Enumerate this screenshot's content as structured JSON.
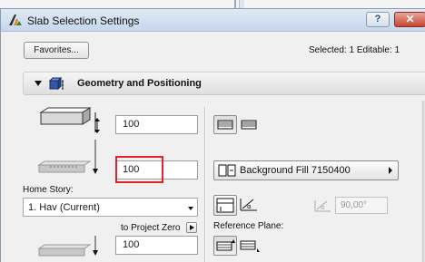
{
  "window": {
    "title": "Slab Selection Settings",
    "help_label": "?",
    "close_label": "✕"
  },
  "toolbar": {
    "favorites_label": "Favorites...",
    "selection_info": "Selected: 1 Editable: 1"
  },
  "panel": {
    "title": "Geometry and Positioning",
    "thickness_value": "100",
    "offset_value": "100",
    "home_story_label": "Home Story:",
    "home_story_value": "1. Hav (Current)",
    "to_project_zero_label": "to Project Zero",
    "project_zero_value": "100",
    "background_fill_label": "Background Fill 7150400",
    "angle_value": "90,00°",
    "reference_plane_label": "Reference Plane:"
  },
  "colors": {
    "highlight": "#e0262b",
    "close_button": "#c6452f",
    "titlebar": "#c6d7ec"
  }
}
